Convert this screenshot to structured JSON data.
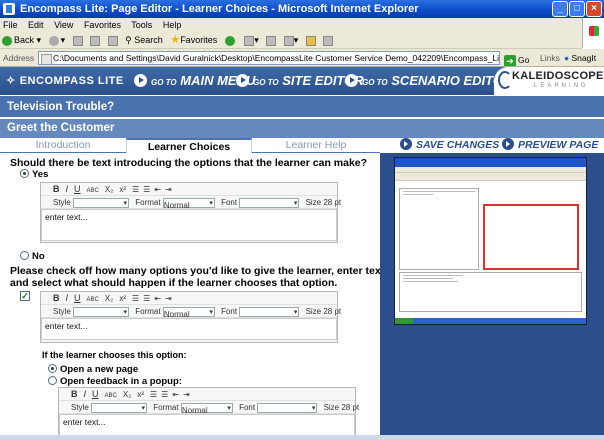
{
  "window": {
    "title": "Encompass Lite: Page Editor - Learner Choices - Microsoft Internet Explorer",
    "controls": [
      "_",
      "□",
      "×"
    ]
  },
  "menu": [
    "File",
    "Edit",
    "View",
    "Favorites",
    "Tools",
    "Help"
  ],
  "toolbar": {
    "back": "Back",
    "search": "Search",
    "favorites": "Favorites"
  },
  "address": {
    "label": "Address",
    "url": "C:\\Documents and Settings\\David Guralnick\\Desktop\\EncompassLite Customer Service Demo_042209\\Encompass_Lite__Page_Editor_-_Learner_Choices.",
    "go": "Go",
    "links": "Links",
    "snagit": "SnagIt"
  },
  "nav": {
    "brand": "ENCOMPASS LITE",
    "go_to": "GO TO",
    "main_menu": "MAIN MENU",
    "site_editor": "SITE EDITOR",
    "scenario_editor": "SCENARIO EDITOR",
    "logo_name": "KALEIDOSCOPE",
    "logo_sub": "LEARNING"
  },
  "header": {
    "course": "Television Trouble?",
    "page": "Greet the Customer"
  },
  "tabs": [
    {
      "label": "Introduction"
    },
    {
      "label": "Learner Choices"
    },
    {
      "label": "Learner Help"
    }
  ],
  "actions": {
    "save": "SAVE CHANGES",
    "preview": "PREVIEW PAGE"
  },
  "form": {
    "q1": "Should there be text introducing the options that the learner can make?",
    "yes": "Yes",
    "no": "No",
    "q2_line1": "Please check off how many options you'd like to give the learner, enter text for each option,",
    "q2_line2": "and select what should happen if the learner chooses that option.",
    "check_mark": "✓",
    "if_chooses": "If the learner chooses this option:",
    "open_new": "Open a new page",
    "open_feedback": "Open feedback in a popup:"
  },
  "editor": {
    "bold": "B",
    "italic": "I",
    "underline": "U",
    "strike": "ABC",
    "sub": "X₂",
    "sup": "x²",
    "style_label": "Style",
    "format_label": "Format",
    "format_value": "Normal",
    "font_label": "Font",
    "size_label": "Size",
    "size_value": "28 pt",
    "placeholder": "enter text..."
  }
}
